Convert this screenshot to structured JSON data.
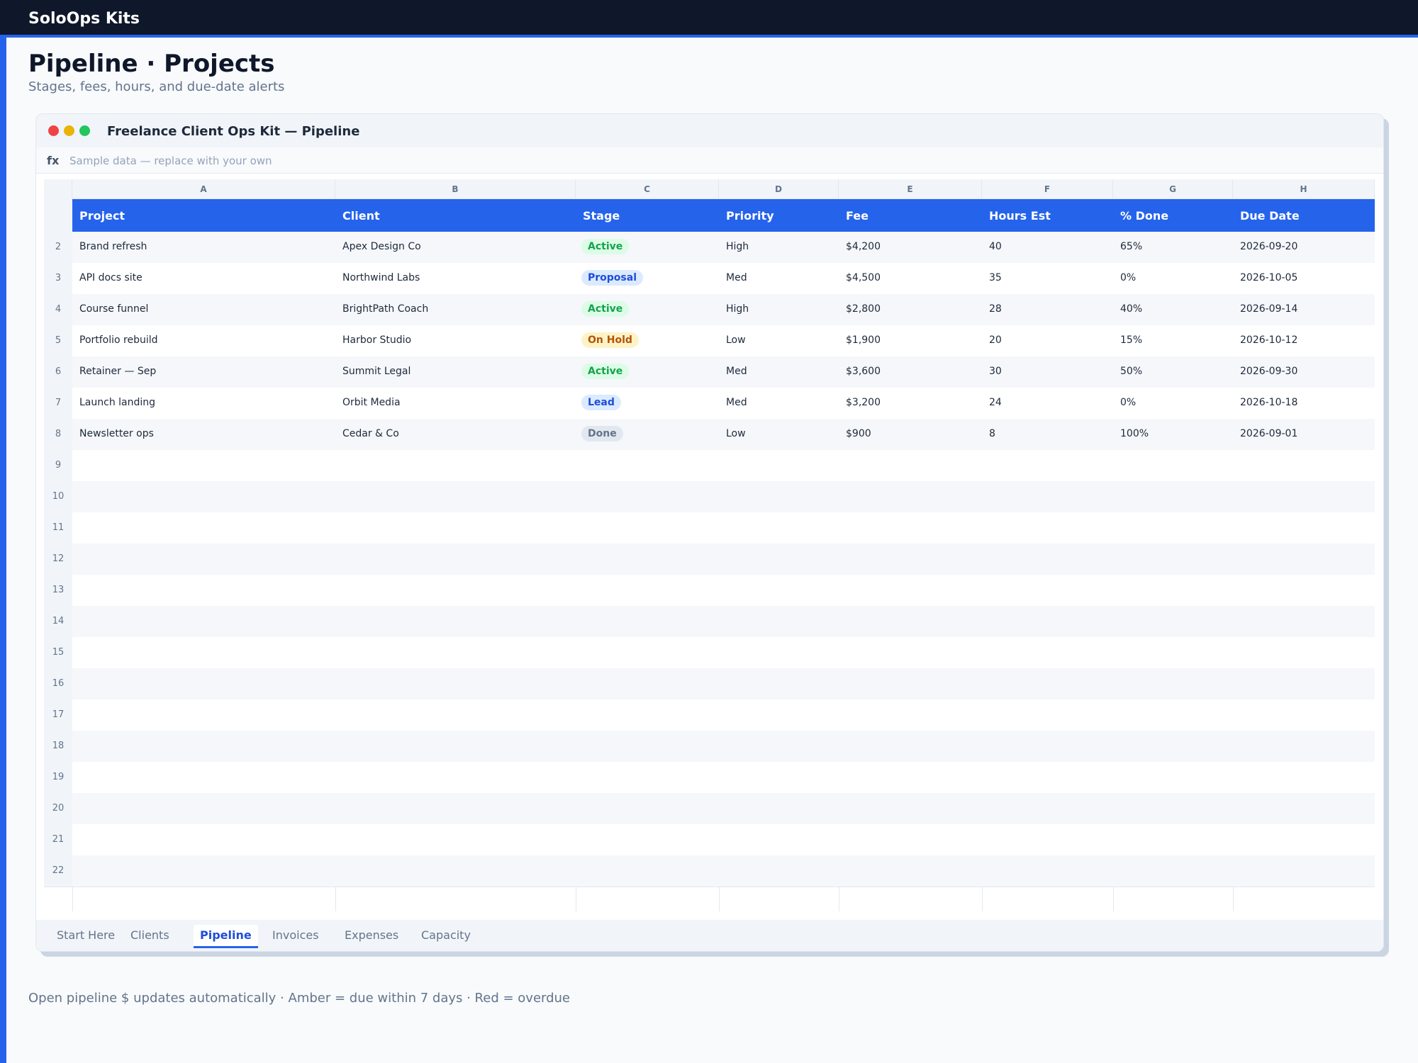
{
  "app": {
    "brand": "SoloOps Kits"
  },
  "page": {
    "title": "Pipeline · Projects",
    "subtitle": "Stages, fees, hours, and due-date alerts"
  },
  "window": {
    "title": "Freelance Client Ops Kit — Pipeline"
  },
  "formula_bar": {
    "fx_label": "fx",
    "text": "Sample data — replace with your own"
  },
  "columns": [
    "A",
    "B",
    "C",
    "D",
    "E",
    "F",
    "G",
    "H"
  ],
  "headers": [
    "Project",
    "Client",
    "Stage",
    "Priority",
    "Fee",
    "Hours Est",
    "% Done",
    "Due Date"
  ],
  "rows": [
    {
      "num": "2",
      "project": "Brand refresh",
      "client": "Apex Design Co",
      "stage": "Active",
      "priority": "High",
      "fee": "$4,200",
      "hours": "40",
      "done": "65%",
      "due": "2026-09-20"
    },
    {
      "num": "3",
      "project": "API docs site",
      "client": "Northwind Labs",
      "stage": "Proposal",
      "priority": "Med",
      "fee": "$4,500",
      "hours": "35",
      "done": "0%",
      "due": "2026-10-05"
    },
    {
      "num": "4",
      "project": "Course funnel",
      "client": "BrightPath Coach",
      "stage": "Active",
      "priority": "High",
      "fee": "$2,800",
      "hours": "28",
      "done": "40%",
      "due": "2026-09-14"
    },
    {
      "num": "5",
      "project": "Portfolio rebuild",
      "client": "Harbor Studio",
      "stage": "On Hold",
      "priority": "Low",
      "fee": "$1,900",
      "hours": "20",
      "done": "15%",
      "due": "2026-10-12"
    },
    {
      "num": "6",
      "project": "Retainer — Sep",
      "client": "Summit Legal",
      "stage": "Active",
      "priority": "Med",
      "fee": "$3,600",
      "hours": "30",
      "done": "50%",
      "due": "2026-09-30"
    },
    {
      "num": "7",
      "project": "Launch landing",
      "client": "Orbit Media",
      "stage": "Lead",
      "priority": "Med",
      "fee": "$3,200",
      "hours": "24",
      "done": "0%",
      "due": "2026-10-18"
    },
    {
      "num": "8",
      "project": "Newsletter ops",
      "client": "Cedar & Co",
      "stage": "Done",
      "priority": "Low",
      "fee": "$900",
      "hours": "8",
      "done": "100%",
      "due": "2026-09-01"
    }
  ],
  "empty_row_numbers": [
    "9",
    "10",
    "11",
    "12",
    "13",
    "14",
    "15",
    "16",
    "17",
    "18",
    "19",
    "20",
    "21",
    "22"
  ],
  "tabs": [
    {
      "label": "Start Here",
      "active": false
    },
    {
      "label": "Clients",
      "active": false
    },
    {
      "label": "Pipeline",
      "active": true
    },
    {
      "label": "Invoices",
      "active": false
    },
    {
      "label": "Expenses",
      "active": false
    },
    {
      "label": "Capacity",
      "active": false
    }
  ],
  "footer": {
    "note": "Open pipeline $ updates automatically  ·  Amber = due within 7 days  ·  Red = overdue"
  },
  "colors": {
    "accent": "#2563eb",
    "topbar": "#0f172a",
    "active": "#16a34a",
    "proposal": "#1d4ed8",
    "on_hold": "#b45309",
    "done": "#64748b"
  }
}
